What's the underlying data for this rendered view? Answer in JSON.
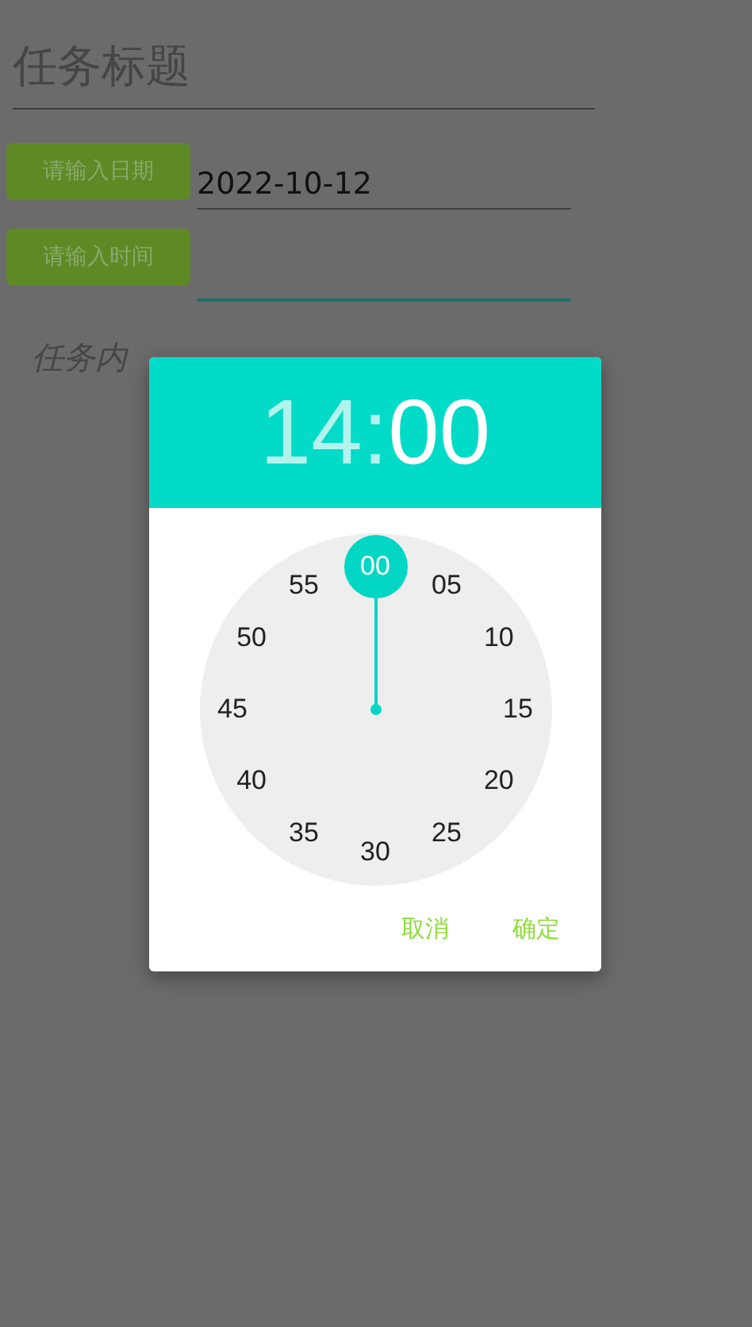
{
  "form": {
    "title_placeholder": "任务标题",
    "date_button": "请输入日期",
    "date_value": "2022-10-12",
    "time_button": "请输入时间",
    "time_focused": true,
    "content_label": "任务内"
  },
  "time_dialog": {
    "header": [
      {
        "text": "14",
        "selected": false
      },
      {
        "text": ":",
        "selected": false
      },
      {
        "text": "00",
        "selected": true
      }
    ],
    "dial": [
      {
        "label": "00",
        "selected": true
      },
      {
        "label": "05",
        "selected": false
      },
      {
        "label": "10",
        "selected": false
      },
      {
        "label": "15",
        "selected": false
      },
      {
        "label": "20",
        "selected": false
      },
      {
        "label": "25",
        "selected": false
      },
      {
        "label": "30",
        "selected": false
      },
      {
        "label": "35",
        "selected": false
      },
      {
        "label": "40",
        "selected": false
      },
      {
        "label": "45",
        "selected": false
      },
      {
        "label": "50",
        "selected": false
      },
      {
        "label": "55",
        "selected": false
      }
    ],
    "buttons": [
      "取消",
      "确定"
    ]
  }
}
